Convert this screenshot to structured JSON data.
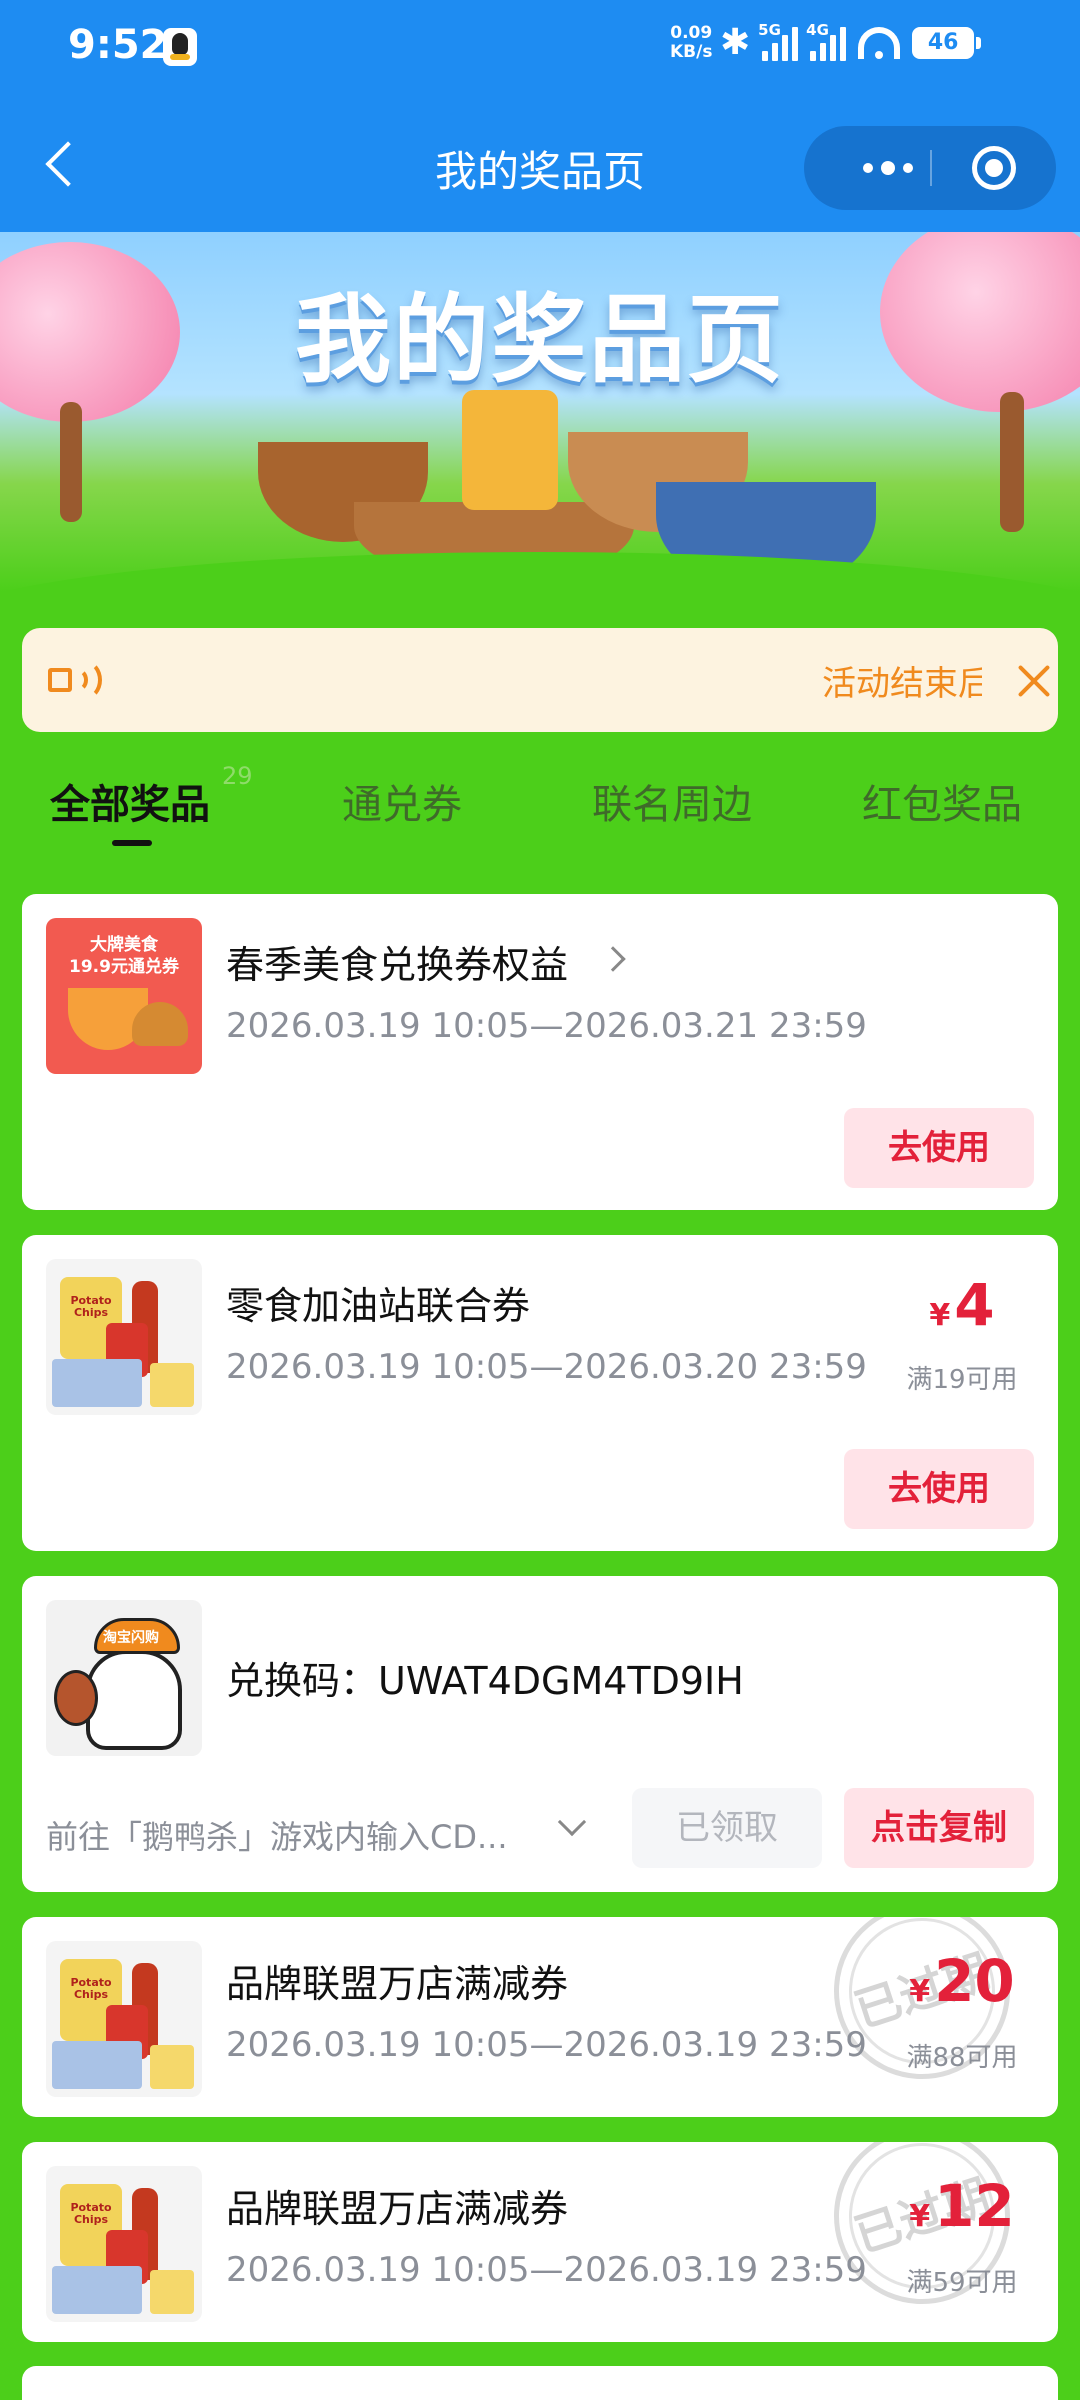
{
  "status_bar": {
    "time": "9:52",
    "net_speed": "0.09",
    "net_unit": "KB/s",
    "sig1_label": "5G",
    "sig2_label": "4G",
    "battery": "46"
  },
  "nav": {
    "title": "我的奖品页"
  },
  "banner": {
    "title": "我的奖品页"
  },
  "notice": {
    "text": "活动结束后"
  },
  "tabs": [
    {
      "label": "全部奖品",
      "badge": "29"
    },
    {
      "label": "通兑券"
    },
    {
      "label": "联名周边"
    },
    {
      "label": "红包奖品"
    }
  ],
  "cards": [
    {
      "thumb_text_1": "大牌美食",
      "thumb_text_2": "19.9元通兑券",
      "title": "春季美食兑换券权益",
      "date": "2026.03.19 10:05—2026.03.21 23:59",
      "button": "去使用"
    },
    {
      "title": "零食加油站联合券",
      "date": "2026.03.19 10:05—2026.03.20 23:59",
      "currency": "¥",
      "amount": "4",
      "condition": "满19可用",
      "button": "去使用"
    },
    {
      "title": "兑换码：UWAT4DGM4TD9IH",
      "hint": "前往「鹅鸭杀」游戏内输入CD...",
      "claimed_button": "已领取",
      "copy_button": "点击复制"
    },
    {
      "title": "品牌联盟万店满减券",
      "date": "2026.03.19 10:05—2026.03.19 23:59",
      "currency": "¥",
      "amount": "20",
      "condition": "满88可用",
      "stamp": "已过期"
    },
    {
      "title": "品牌联盟万店满减券",
      "date": "2026.03.19 10:05—2026.03.19 23:59",
      "currency": "¥",
      "amount": "12",
      "condition": "满59可用",
      "stamp": "已过期"
    }
  ],
  "colors": {
    "primary_blue": "#1e8cf2",
    "page_green": "#4ccf1a",
    "accent_red": "#e3213a",
    "notice_orange": "#f08a1e"
  }
}
